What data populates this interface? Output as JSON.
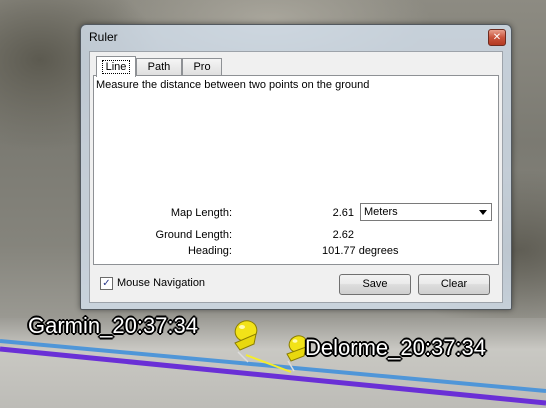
{
  "window": {
    "title": "Ruler",
    "close_glyph": "✕"
  },
  "tabs": [
    {
      "label": "Line",
      "active": true
    },
    {
      "label": "Path",
      "active": false
    },
    {
      "label": "Pro",
      "active": false
    }
  ],
  "panel": {
    "description": "Measure the distance between two points on the ground",
    "map_length_label": "Map Length:",
    "map_length_value": "2.61",
    "units": {
      "selected": "Meters"
    },
    "ground_length_label": "Ground Length:",
    "ground_length_value": "2.62",
    "heading_label": "Heading:",
    "heading_value": "101.77 degrees"
  },
  "mouse_navigation": {
    "label": "Mouse Navigation",
    "checked": true,
    "check_glyph": "✓"
  },
  "buttons": {
    "save": "Save",
    "clear": "Clear"
  },
  "placemarks": [
    {
      "name": "Garmin_20:37:34"
    },
    {
      "name": "Delorme_20:37:34"
    }
  ],
  "colors": {
    "track_purple": "#6a2fd6",
    "track_blue": "#4f96d8",
    "pushpin_yellow": "#f2e318",
    "ruler_line": "#f5ee2a"
  }
}
